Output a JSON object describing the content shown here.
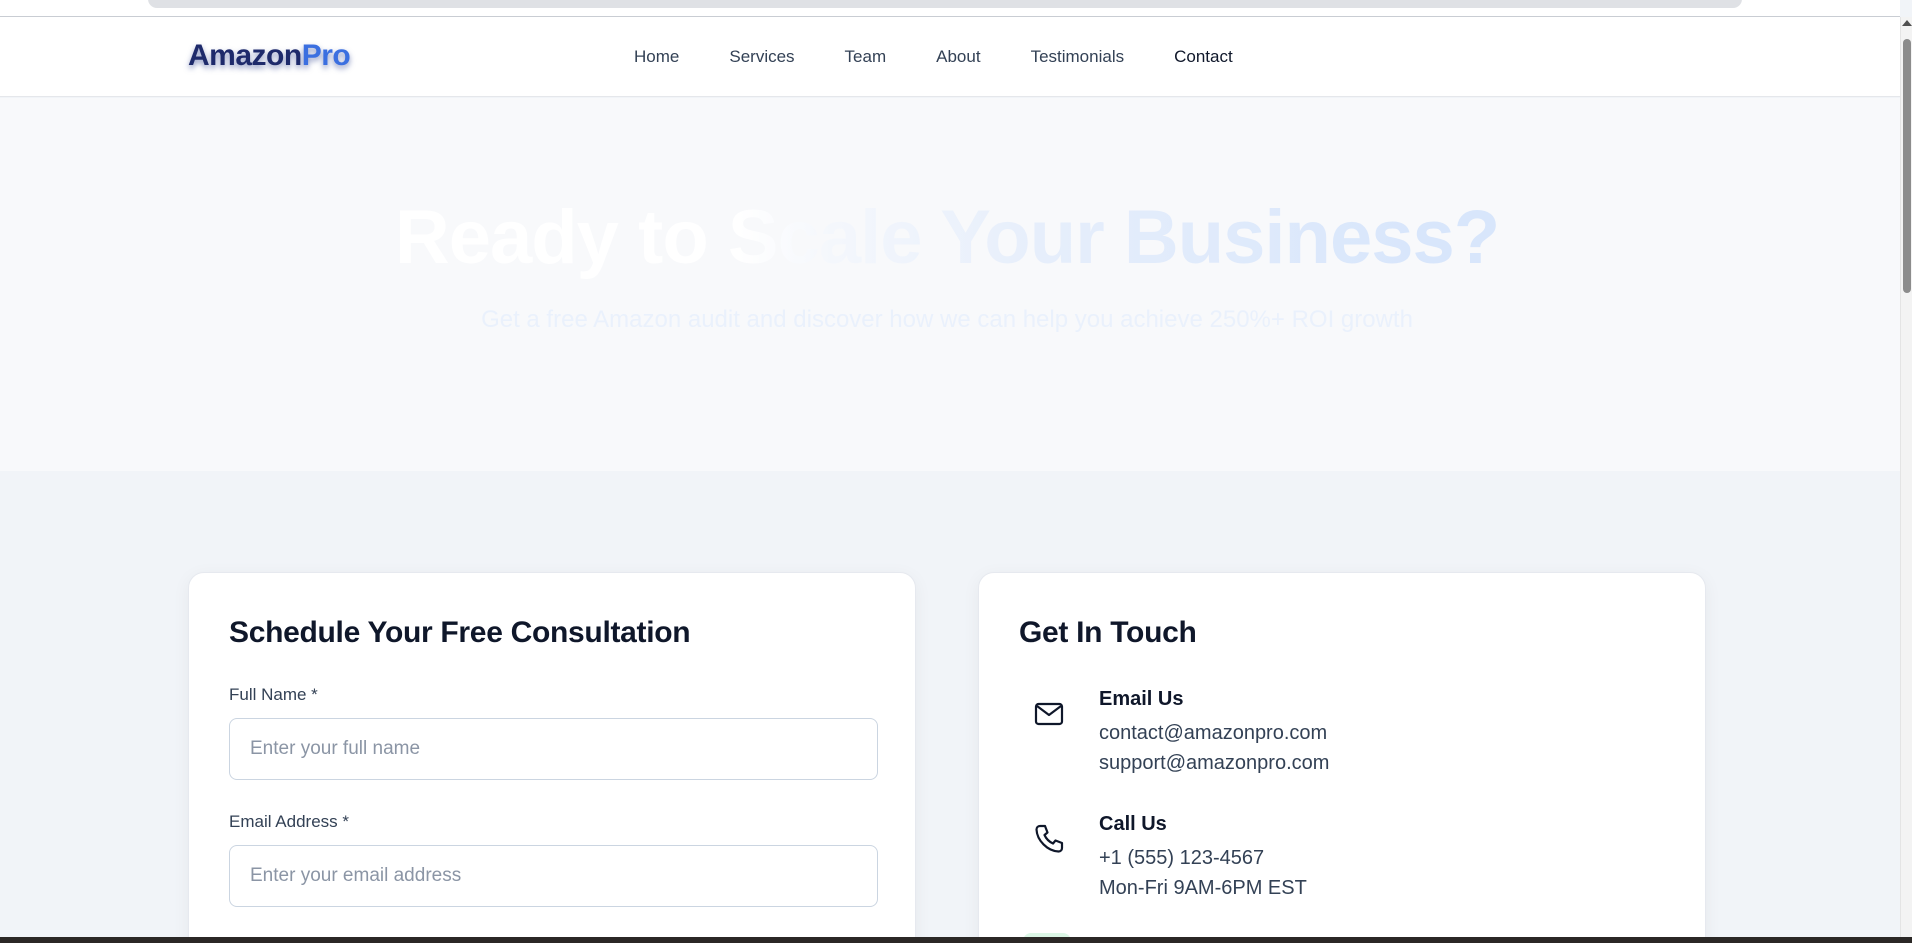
{
  "logo": {
    "part1": "Amazon",
    "part2": "Pro"
  },
  "nav": {
    "links": [
      {
        "label": "Home"
      },
      {
        "label": "Services"
      },
      {
        "label": "Team"
      },
      {
        "label": "About"
      },
      {
        "label": "Testimonials"
      },
      {
        "label": "Contact"
      }
    ],
    "active": "Contact"
  },
  "hero": {
    "title": "Ready to Scale Your Business?",
    "subtitle": "Get a free Amazon audit and discover how we can help you achieve 250%+ ROI growth"
  },
  "consultation_form": {
    "title": "Schedule Your Free Consultation",
    "full_name": {
      "label": "Full Name *",
      "placeholder": "Enter your full name",
      "value": ""
    },
    "email": {
      "label": "Email Address *",
      "placeholder": "Enter your email address",
      "value": ""
    }
  },
  "get_in_touch": {
    "title": "Get In Touch",
    "email": {
      "heading": "Email Us",
      "lines": [
        "contact@amazonpro.com",
        "support@amazonpro.com"
      ],
      "icon": "mail-icon"
    },
    "phone": {
      "heading": "Call Us",
      "lines": [
        "+1 (555) 123-4567",
        "Mon-Fri 9AM-6PM EST"
      ],
      "icon": "phone-icon"
    }
  },
  "colors": {
    "brand_dark": "#1e2a6b",
    "brand_accent": "#3b6fe0",
    "page_bg": "#f1f4f8",
    "text_primary": "#0f172a"
  }
}
